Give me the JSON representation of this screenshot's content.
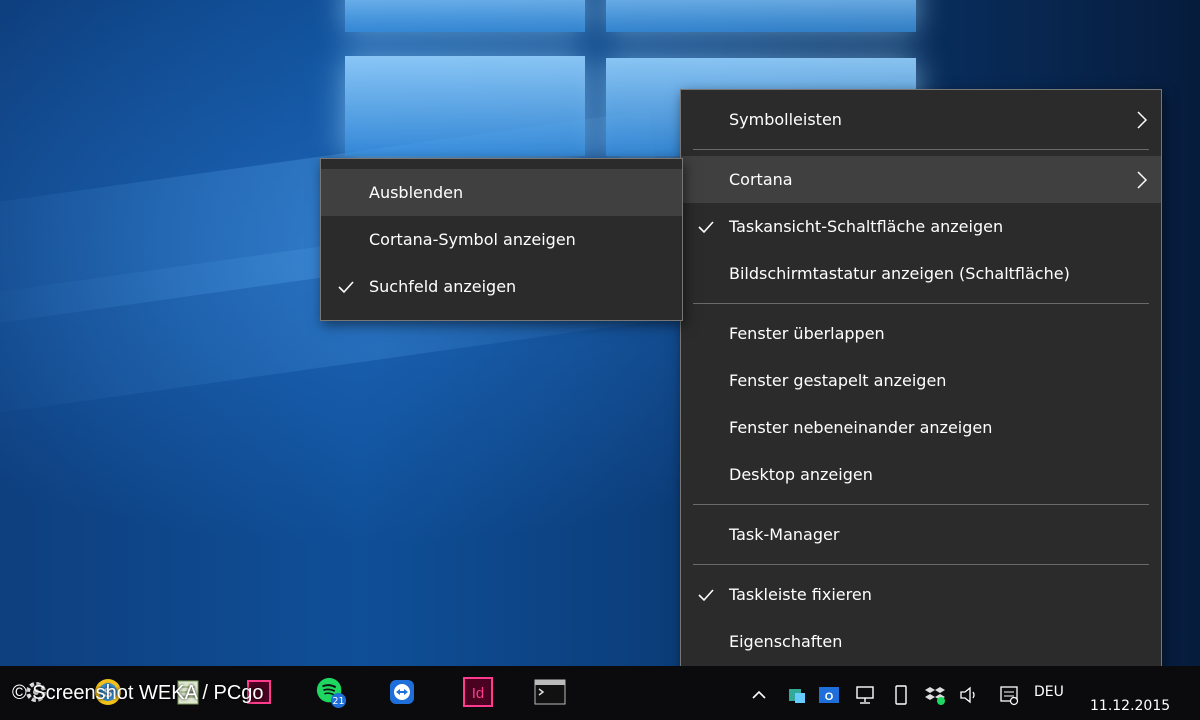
{
  "main_menu": {
    "groups": [
      [
        {
          "label": "Symbolleisten",
          "checked": false,
          "submenu": true
        }
      ],
      [
        {
          "label": "Cortana",
          "checked": false,
          "submenu": true,
          "highlighted": true
        },
        {
          "label": "Taskansicht-Schaltfläche anzeigen",
          "checked": true,
          "submenu": false
        },
        {
          "label": "Bildschirmtastatur anzeigen (Schaltfläche)",
          "checked": false,
          "submenu": false
        }
      ],
      [
        {
          "label": "Fenster überlappen",
          "checked": false
        },
        {
          "label": "Fenster gestapelt anzeigen",
          "checked": false
        },
        {
          "label": "Fenster nebeneinander anzeigen",
          "checked": false
        },
        {
          "label": "Desktop anzeigen",
          "checked": false
        }
      ],
      [
        {
          "label": "Task-Manager",
          "checked": false
        }
      ],
      [
        {
          "label": "Taskleiste fixieren",
          "checked": true
        },
        {
          "label": "Eigenschaften",
          "checked": false
        }
      ]
    ]
  },
  "cortana_submenu": {
    "items": [
      {
        "label": "Ausblenden",
        "checked": false,
        "highlighted": true
      },
      {
        "label": "Cortana-Symbol anzeigen",
        "checked": false
      },
      {
        "label": "Suchfeld anzeigen",
        "checked": true
      }
    ]
  },
  "taskbar": {
    "apps": [
      {
        "icon": "gear-icon"
      },
      {
        "icon": "s-app-icon"
      },
      {
        "icon": "notepad-icon"
      },
      {
        "icon": "indesign-doc-icon"
      },
      {
        "icon": "spotify-icon",
        "badge": "21"
      },
      {
        "icon": "teamviewer-icon"
      },
      {
        "icon": "indesign-icon",
        "label": "Id"
      },
      {
        "icon": "terminal-icon"
      }
    ],
    "tray": {
      "language": "DEU",
      "date": "11.12.2015"
    }
  },
  "watermark": "© Screenshot WEKA / PCgo",
  "colors": {
    "menu_bg": "#2b2b2b",
    "menu_highlight": "#404040",
    "indesign_pink": "#ff3b8e",
    "spotify_green": "#1ed760",
    "teamviewer_blue": "#1e6fd9"
  }
}
